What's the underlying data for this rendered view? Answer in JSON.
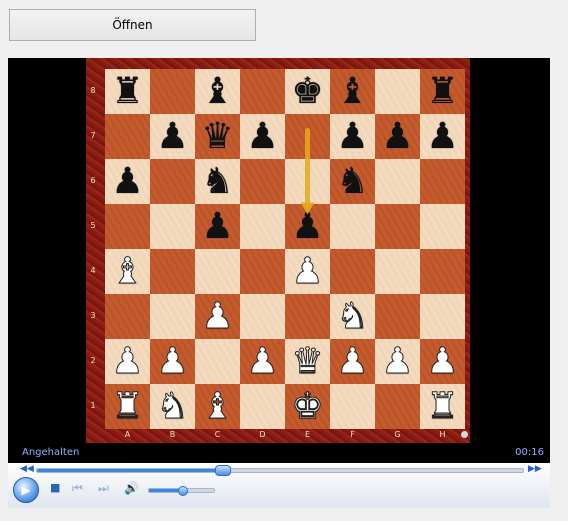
{
  "open_button": {
    "label": "Öffnen"
  },
  "board": {
    "ranks": [
      "8",
      "7",
      "6",
      "5",
      "4",
      "3",
      "2",
      "1"
    ],
    "files": [
      "A",
      "B",
      "C",
      "D",
      "E",
      "F",
      "G",
      "H"
    ],
    "pieces": {
      "a8": "br",
      "c8": "bb",
      "e8": "bk",
      "f8": "bb",
      "h8": "br",
      "b7": "bp",
      "c7": "bq",
      "d7": "bp",
      "f7": "bp",
      "g7": "bp",
      "h7": "bp",
      "a6": "bp",
      "c6": "bn",
      "f6": "bn",
      "c5": "bp",
      "e5": "bp",
      "a4": "wb",
      "e4": "wp",
      "c3": "wp",
      "f3": "wn",
      "a2": "wp",
      "b2": "wp",
      "d2": "wp",
      "e2": "wq",
      "f2": "wp",
      "g2": "wp",
      "h2": "wp",
      "a1": "wr",
      "b1": "wn",
      "c1": "wb",
      "e1": "wk",
      "h1": "wr"
    },
    "highlight_arrow": {
      "from": "e7",
      "to": "e5",
      "color": "#e6a91e"
    }
  },
  "player": {
    "status": "Angehalten",
    "time": "00:16",
    "progress": 0.38,
    "volume": 0.5,
    "accent_color": "#3a86e8",
    "icons": {
      "rewind": "rewind-icon",
      "fast_forward": "fast-forward-icon",
      "play": "play-icon",
      "stop": "stop-icon",
      "previous": "previous-icon",
      "next": "next-icon",
      "volume": "volume-icon"
    }
  }
}
